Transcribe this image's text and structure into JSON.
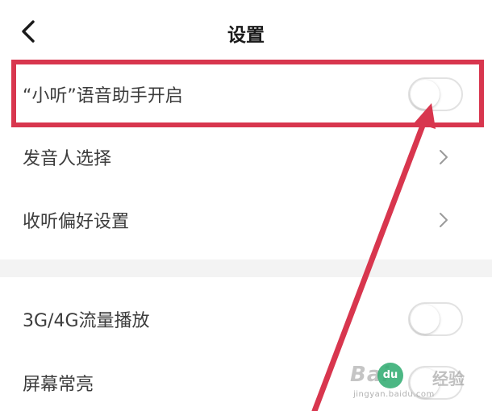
{
  "header": {
    "title": "设置",
    "back_icon": "chevron-left-icon"
  },
  "section1": {
    "items": [
      {
        "label": "“小听”语音助手开启",
        "control": "toggle",
        "state": "off"
      },
      {
        "label": "发音人选择",
        "control": "chevron"
      },
      {
        "label": "收听偏好设置",
        "control": "chevron"
      }
    ]
  },
  "section2": {
    "items": [
      {
        "label": "3G/4G流量播放",
        "control": "toggle",
        "state": "off"
      },
      {
        "label": "屏幕常亮",
        "control": "toggle",
        "state": "off"
      }
    ]
  },
  "annotation": {
    "highlight_color": "#d8364e",
    "arrow_color": "#d8364e"
  },
  "watermark": {
    "logo": "Bai",
    "paw": "du",
    "jingyan": "经验",
    "url": "jingyan.baidu.com"
  },
  "colors": {
    "background": "#ffffff",
    "text": "#3c3c3c",
    "title": "#1a1a1a",
    "section_gap": "#f3f3f3",
    "toggle_border": "#e2e2e2"
  }
}
